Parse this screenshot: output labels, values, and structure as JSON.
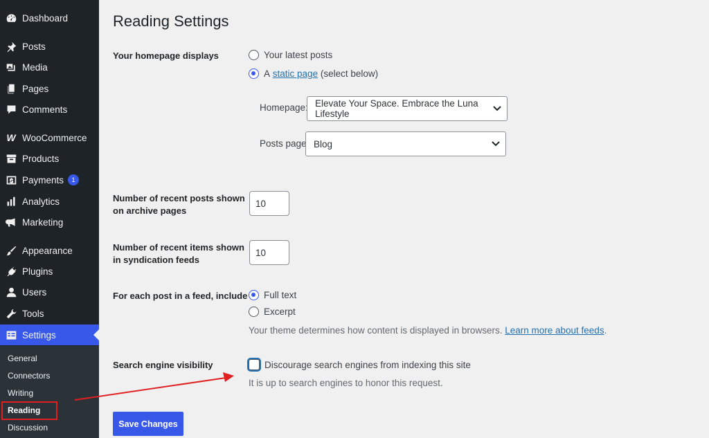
{
  "sidebar": {
    "items": [
      {
        "label": "Dashboard",
        "icon": "dashboard-icon"
      },
      {
        "label": "Posts",
        "icon": "pin-icon"
      },
      {
        "label": "Media",
        "icon": "media-icon"
      },
      {
        "label": "Pages",
        "icon": "pages-icon"
      },
      {
        "label": "Comments",
        "icon": "comment-icon"
      },
      {
        "label": "WooCommerce",
        "icon": "woocommerce-icon"
      },
      {
        "label": "Products",
        "icon": "archive-icon"
      },
      {
        "label": "Payments",
        "icon": "dollar-icon",
        "badge": "1"
      },
      {
        "label": "Analytics",
        "icon": "chart-bar-icon"
      },
      {
        "label": "Marketing",
        "icon": "megaphone-icon"
      },
      {
        "label": "Appearance",
        "icon": "brush-icon"
      },
      {
        "label": "Plugins",
        "icon": "plug-icon"
      },
      {
        "label": "Users",
        "icon": "user-icon"
      },
      {
        "label": "Tools",
        "icon": "wrench-icon"
      },
      {
        "label": "Settings",
        "icon": "settings-icon"
      }
    ],
    "submenu": [
      "General",
      "Connectors",
      "Writing",
      "Reading",
      "Discussion"
    ]
  },
  "page": {
    "title": "Reading Settings",
    "homepage_displays": {
      "label": "Your homepage displays",
      "option_latest": "Your latest posts",
      "option_static_prefix": "A",
      "option_static_link": "static page",
      "option_static_suffix": "(select below)",
      "homepage_label": "Homepage:",
      "homepage_value": "Elevate Your Space. Embrace the Luna Lifestyle",
      "posts_page_label": "Posts page:",
      "posts_page_value": "Blog"
    },
    "archive_posts": {
      "label_line1": "Number of recent posts shown",
      "label_line2": "on archive pages",
      "value": "10"
    },
    "syndication": {
      "label_line1": "Number of recent items shown",
      "label_line2": "in syndication feeds",
      "value": "10"
    },
    "feed_include": {
      "label": "For each post in a feed, include",
      "option_full": "Full text",
      "option_excerpt": "Excerpt",
      "desc_text": "Your theme determines how content is displayed in browsers.",
      "desc_link": "Learn more about feeds",
      "desc_end": "."
    },
    "search_visibility": {
      "label": "Search engine visibility",
      "checkbox_label": "Discourage search engines from indexing this site",
      "desc": "It is up to search engines to honor this request."
    },
    "save_button": "Save Changes"
  },
  "colors": {
    "sidebar_bg": "#1d2327",
    "accent": "#3858e9",
    "annotation": "#e02020"
  }
}
